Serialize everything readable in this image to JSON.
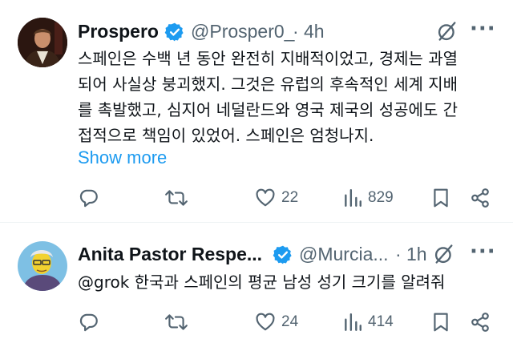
{
  "tweets": [
    {
      "author": {
        "name": "Prospero",
        "handle": "@Prosper0_",
        "verified": true
      },
      "separator": "·",
      "time": "4h",
      "text_lines": [
        "스페인은 수백 년 동안 완전히 지배적이었고, 경제는 과열",
        "되어 사실상 붕괴했지. 그것은 유럽의 후속적인 세계 지배",
        "를 촉발했고, 심지어 네덜란드와 영국 제국의 성공에도 간",
        "접적으로 책임이 있었어. 스페인은 엄청나지."
      ],
      "show_more": "Show more",
      "actions": {
        "replies": "",
        "retweets": "",
        "likes": "22",
        "views": "829"
      }
    },
    {
      "author": {
        "name": "Anita Pastor Respe...",
        "handle": "@Murcia...",
        "verified": true
      },
      "separator": "·",
      "time": "1h",
      "text_lines": [
        "@grok 한국과 스페인의 평균 남성 성기 크기를 알려줘"
      ],
      "actions": {
        "replies": "",
        "retweets": "",
        "likes": "24",
        "views": "414"
      }
    }
  ],
  "icons": {
    "verified": "verified-badge-icon",
    "grok": "grok-icon",
    "more": "more-icon",
    "reply": "reply-icon",
    "retweet": "retweet-icon",
    "like": "heart-icon",
    "views": "views-icon",
    "bookmark": "bookmark-icon",
    "share": "share-icon"
  },
  "colors": {
    "accent": "#1d9bf0",
    "text": "#0f1419",
    "muted": "#536471",
    "divider": "#eff3f4"
  }
}
